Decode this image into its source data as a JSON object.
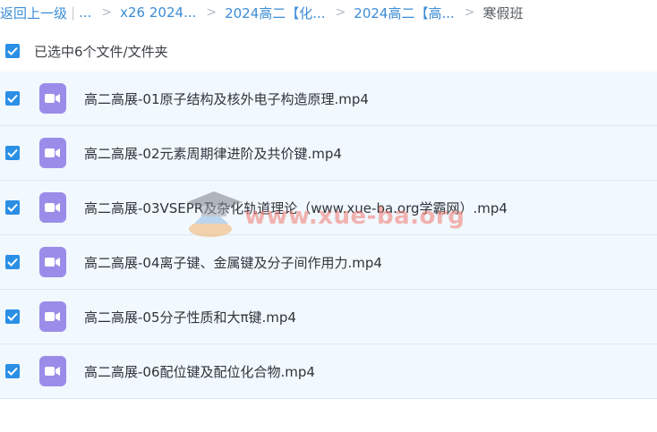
{
  "breadcrumb": {
    "back": "返回上一级",
    "divider": "|",
    "ellipsis": "...",
    "chevron": ">",
    "items": [
      "x26 2024...",
      "2024高二【化...",
      "2024高二【高..."
    ],
    "current": "寒假班"
  },
  "selection": {
    "label": "已选中6个文件/文件夹",
    "checked": true
  },
  "files": [
    {
      "name": "高二高展-01原子结构及核外电子构造原理.mp4",
      "checked": true
    },
    {
      "name": "高二高展-02元素周期律进阶及共价键.mp4",
      "checked": true
    },
    {
      "name": "高二高展-03VSEPR及杂化轨道理论（www.xue-ba.org学霸网）.mp4",
      "checked": true
    },
    {
      "name": "高二高展-04离子键、金属键及分子间作用力.mp4",
      "checked": true
    },
    {
      "name": "高二高展-05分子性质和大π键.mp4",
      "checked": true
    },
    {
      "name": "高二高展-06配位键及配位化合物.mp4",
      "checked": true
    }
  ],
  "watermark": {
    "text": "www.xue-ba.org"
  },
  "colors": {
    "link": "#3b8cd6",
    "checkbox": "#2b8fe5",
    "row_bg": "#f1f8fe",
    "video_icon": "#9b8ce9"
  },
  "icons": {
    "checkbox": "check-icon",
    "file": "video-file-icon",
    "watermark": "graduation-cap-icon"
  }
}
